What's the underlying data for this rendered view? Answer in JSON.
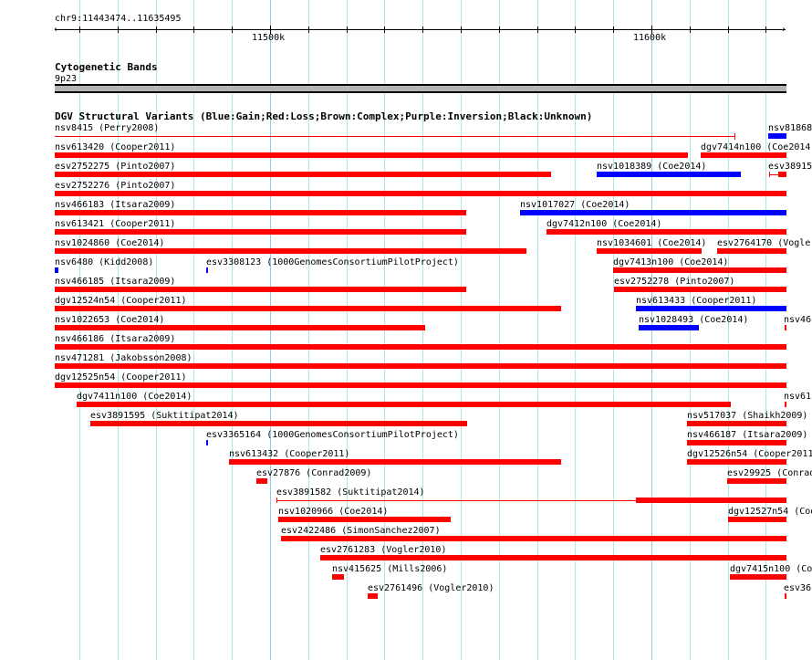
{
  "ruler": {
    "region": "chr9:11443474..11635495",
    "major_ticks": [
      "11500k",
      "11600k"
    ]
  },
  "cytoband_track": {
    "title": "Cytogenetic Bands",
    "band": "9p23",
    "band_color": "#b3b3b3"
  },
  "sv_track": {
    "title": "DGV Structural Variants (Blue:Gain;Red:Loss;Brown:Complex;Purple:Inversion;Black:Unknown)",
    "colors": {
      "gain": "#0000ff",
      "loss": "#ff0000"
    },
    "features": [
      {
        "label": "nsv8415 (Perry2008)",
        "type": "loss"
      },
      {
        "label": "nsv81868",
        "type": "gain"
      },
      {
        "label": "nsv613420 (Cooper2011)",
        "type": "loss"
      },
      {
        "label": "dgv7414n100 (Coe2014)",
        "type": "loss"
      },
      {
        "label": "esv2752275 (Pinto2007)",
        "type": "loss"
      },
      {
        "label": "nsv1018389 (Coe2014)",
        "type": "gain"
      },
      {
        "label": "esv38915",
        "type": "loss"
      },
      {
        "label": "esv2752276 (Pinto2007)",
        "type": "loss"
      },
      {
        "label": "nsv466183 (Itsara2009)",
        "type": "loss"
      },
      {
        "label": "nsv1017027 (Coe2014)",
        "type": "gain"
      },
      {
        "label": "nsv613421 (Cooper2011)",
        "type": "loss"
      },
      {
        "label": "dgv7412n100 (Coe2014)",
        "type": "loss"
      },
      {
        "label": "nsv1024860 (Coe2014)",
        "type": "loss"
      },
      {
        "label": "nsv1034601 (Coe2014)",
        "type": "loss"
      },
      {
        "label": "esv2764170 (Vogler",
        "type": "loss"
      },
      {
        "label": "nsv6480 (Kidd2008)",
        "type": "gain"
      },
      {
        "label": "esv3308123 (1000GenomesConsortiumPilotProject)",
        "type": "gain"
      },
      {
        "label": "dgv7413n100 (Coe2014)",
        "type": "loss"
      },
      {
        "label": "nsv466185 (Itsara2009)",
        "type": "loss"
      },
      {
        "label": "esv2752278 (Pinto2007)",
        "type": "loss"
      },
      {
        "label": "dgv12524n54 (Cooper2011)",
        "type": "loss"
      },
      {
        "label": "nsv613433 (Cooper2011)",
        "type": "gain"
      },
      {
        "label": "nsv1022653 (Coe2014)",
        "type": "loss"
      },
      {
        "label": "nsv1028493 (Coe2014)",
        "type": "gain"
      },
      {
        "label": "nsv46",
        "type": "loss"
      },
      {
        "label": "nsv466186 (Itsara2009)",
        "type": "loss"
      },
      {
        "label": "nsv471281 (Jakobsson2008)",
        "type": "loss"
      },
      {
        "label": "dgv12525n54 (Cooper2011)",
        "type": "loss"
      },
      {
        "label": "dgv7411n100 (Coe2014)",
        "type": "loss"
      },
      {
        "label": "nsv61",
        "type": "loss"
      },
      {
        "label": "esv3891595 (Suktitipat2014)",
        "type": "loss"
      },
      {
        "label": "nsv517037 (Shaikh2009)",
        "type": "loss"
      },
      {
        "label": "esv3365164 (1000GenomesConsortiumPilotProject)",
        "type": "gain"
      },
      {
        "label": "nsv466187 (Itsara2009)",
        "type": "loss"
      },
      {
        "label": "nsv613432 (Cooper2011)",
        "type": "loss"
      },
      {
        "label": "dgv12526n54 (Cooper2011",
        "type": "loss"
      },
      {
        "label": "esv27876 (Conrad2009)",
        "type": "loss"
      },
      {
        "label": "esv29925 (Conrad",
        "type": "loss"
      },
      {
        "label": "esv3891582 (Suktitipat2014)",
        "type": "loss"
      },
      {
        "label": "nsv1020966 (Coe2014)",
        "type": "loss"
      },
      {
        "label": "dgv12527n54 (Coo",
        "type": "loss"
      },
      {
        "label": "esv2422486 (SimonSanchez2007)",
        "type": "loss"
      },
      {
        "label": "esv2761283 (Vogler2010)",
        "type": "loss"
      },
      {
        "label": "nsv415625 (Mills2006)",
        "type": "loss"
      },
      {
        "label": "dgv7415n100 (Co",
        "type": "loss"
      },
      {
        "label": "esv2761496 (Vogler2010)",
        "type": "loss"
      },
      {
        "label": "esv36",
        "type": "loss"
      }
    ]
  }
}
